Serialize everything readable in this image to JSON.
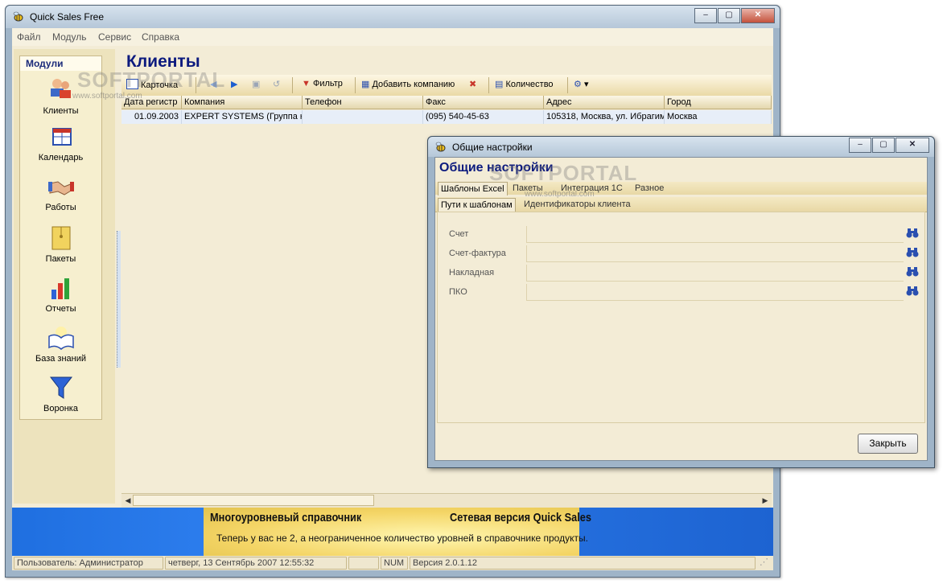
{
  "app": {
    "title": "Quick Sales Free",
    "menu": [
      "Файл",
      "Модуль",
      "Сервис",
      "Справка"
    ]
  },
  "modules": {
    "header": "Модули",
    "items": [
      {
        "label": "Клиенты",
        "icon": "clients-icon"
      },
      {
        "label": "Календарь",
        "icon": "calendar-icon"
      },
      {
        "label": "Работы",
        "icon": "handshake-icon"
      },
      {
        "label": "Пакеты",
        "icon": "package-icon"
      },
      {
        "label": "Отчеты",
        "icon": "bar-chart-icon"
      },
      {
        "label": "База знаний",
        "icon": "book-icon"
      },
      {
        "label": "Воронка",
        "icon": "funnel-icon"
      }
    ]
  },
  "main": {
    "title": "Клиенты",
    "toolbar": {
      "card": "Карточка",
      "filter": "Фильтр",
      "add_company": "Добавить компанию",
      "count": "Количество"
    },
    "columns": [
      "Дата регистр",
      "Компания",
      "Телефон",
      "Факс",
      "Адрес",
      "Город"
    ],
    "rows": [
      [
        "01.09.2003",
        "EXPERT SYSTEMS (Группа ком",
        "",
        "(095) 540-45-63",
        "105318, Москва, ул. Ибрагим",
        "Москва"
      ]
    ]
  },
  "banner": {
    "title_left": "Многоуровневый справочник",
    "title_right": "Сетевая версия Quick Sales",
    "text": "Теперь у вас не 2, а неограниченное количество уровней в справочнике продукты."
  },
  "status": {
    "user": "Пользователь: Администратор",
    "datetime": "четверг, 13 Сентябрь 2007 12:55:32",
    "num": "NUM",
    "version": "Версия 2.0.1.12"
  },
  "watermark": {
    "logo": "SOFTPORTAL",
    "url": "www.softportal.com"
  },
  "dialog": {
    "window_title": "Общие настройки",
    "heading": "Общие настройки",
    "tabs": [
      "Шаблоны Excel",
      "Пакеты",
      "Интеграция 1С",
      "Разное"
    ],
    "subtabs": [
      "Пути к шаблонам",
      "Идентификаторы клиента"
    ],
    "fields": [
      "Счет",
      "Счет-фактура",
      "Накладная",
      "ПКО"
    ],
    "close_button": "Закрыть"
  },
  "colors": {
    "title_blue": "#0c1a7e",
    "panel_beige": "#f3ecd6",
    "banner_blue": "#1f6fe0"
  }
}
